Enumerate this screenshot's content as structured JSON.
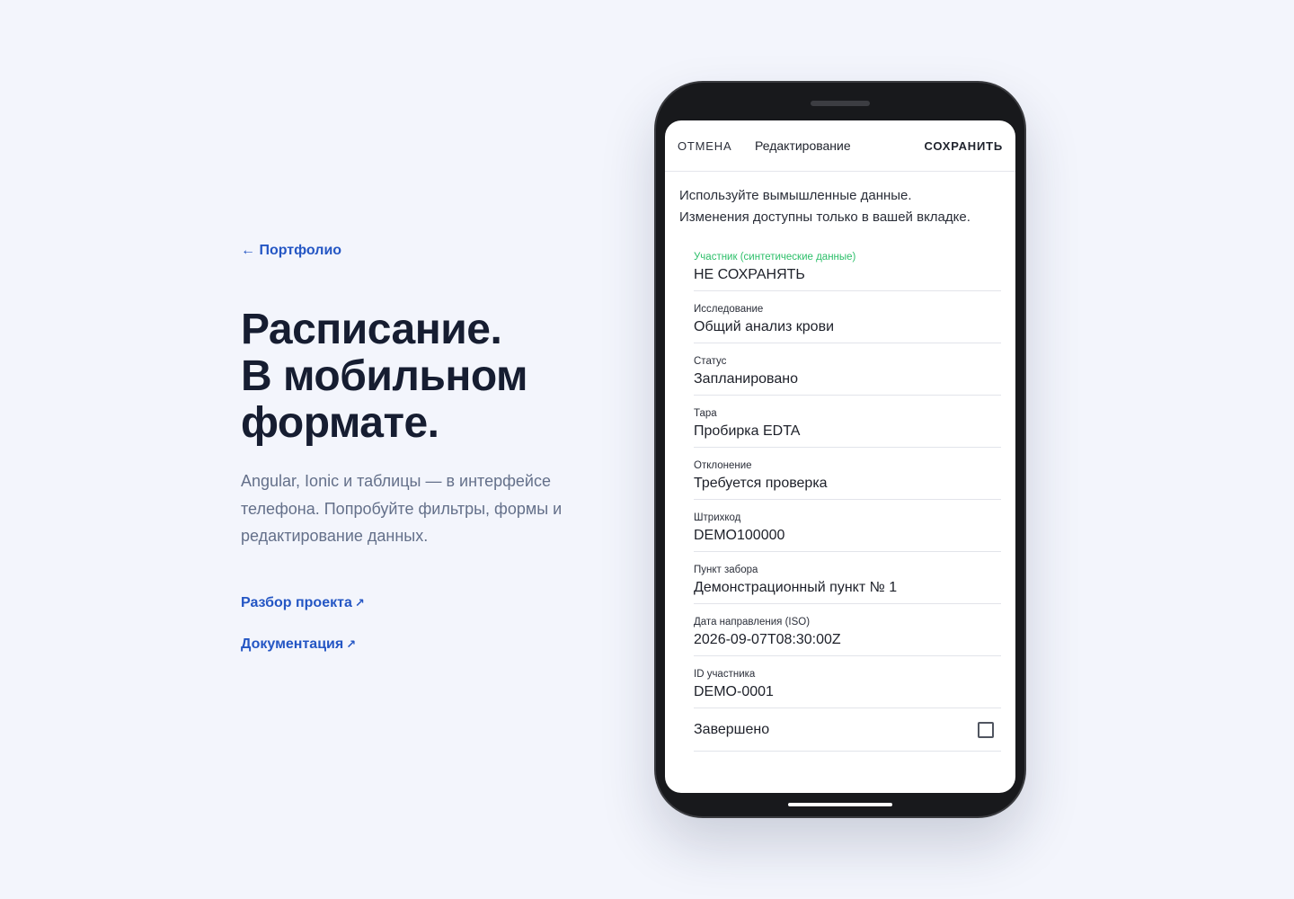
{
  "back_link": "← Портфолио",
  "headline": [
    "Расписание.",
    "В мобильном",
    "формате."
  ],
  "lead": "Angular, Ionic и таблицы — в интерфейсе телефона. Попробуйте фильтры, формы и редактирование данных.",
  "links": [
    {
      "label": "Разбор проекта",
      "arrow": "↗"
    },
    {
      "label": "Документация",
      "arrow": "↗"
    }
  ],
  "phone": {
    "toolbar": {
      "cancel": "ОТМЕНА",
      "title": "Редактирование",
      "save": "СОХРАНИТЬ"
    },
    "intro": [
      "Используйте вымышленные данные.",
      "Изменения доступны только в вашей вкладке."
    ],
    "fields": [
      {
        "label": "Участник (синтетические данные)",
        "value": "НЕ СОХРАНЯТЬ",
        "focused": true
      },
      {
        "label": "Исследование",
        "value": "Общий анализ крови"
      },
      {
        "label": "Статус",
        "value": "Запланировано"
      },
      {
        "label": "Тара",
        "value": "Пробирка EDTA"
      },
      {
        "label": "Отклонение",
        "value": "Требуется проверка"
      },
      {
        "label": "Штрихкод",
        "value": "DEMO100000"
      },
      {
        "label": "Пункт забора",
        "value": "Демонстрационный пункт № 1"
      },
      {
        "label": "Дата направления (ISO)",
        "value": "2026-09-07T08:30:00Z"
      },
      {
        "label": "ID участника",
        "value": "DEMO-0001"
      }
    ],
    "completed": {
      "label": "Завершено",
      "checked": false
    }
  },
  "colors": {
    "background": "#f3f5fc",
    "link": "#2456c4",
    "heading": "#161d31",
    "muted": "#64708a",
    "focus_label": "#2dbf6a",
    "phone_frame": "#18191c"
  }
}
